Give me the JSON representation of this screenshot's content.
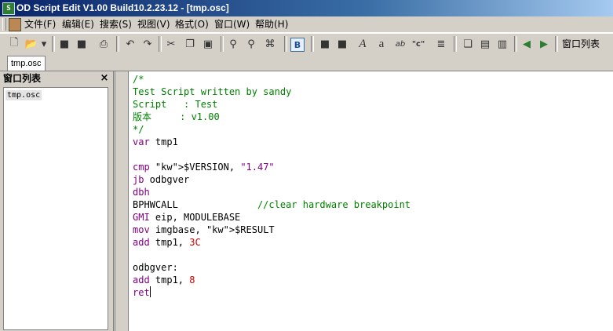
{
  "window": {
    "title": "OD Script Edit V1.00 Build10.2.23.12 - [tmp.osc]",
    "icon": "script-app-icon"
  },
  "menu": [
    "文件(F)",
    "编辑(E)",
    "搜索(S)",
    "视图(V)",
    "格式(O)",
    "窗口(W)",
    "帮助(H)"
  ],
  "toolbar": {
    "font_sample_a_italic": "A",
    "font_sample_a": "a",
    "font_sample_ab": "ab",
    "font_sample_quote": "\"c\"",
    "bold_label": "B",
    "window_list_label": "窗口列表"
  },
  "doc_tab": "tmp.osc",
  "panel": {
    "title": "窗口列表",
    "close": "×",
    "items": [
      "tmp.osc"
    ]
  },
  "code_lines": [
    "/*",
    "Test Script written by sandy",
    "Script   : Test",
    "版本     : v1.00",
    "*/",
    "var tmp1",
    "",
    "cmp $VERSION, \"1.47\"",
    "jb odbgver",
    "dbh",
    "BPHWCALL              //clear hardware breakpoint",
    "GMI eip, MODULEBASE",
    "mov imgbase, $RESULT",
    "add tmp1, 3C",
    "",
    "odbgver:",
    "add tmp1, 8",
    "ret"
  ],
  "colors": {
    "comment": "#008000",
    "keyword": "#800080",
    "number": "#cc0000",
    "title_bar": "#0a246a"
  }
}
